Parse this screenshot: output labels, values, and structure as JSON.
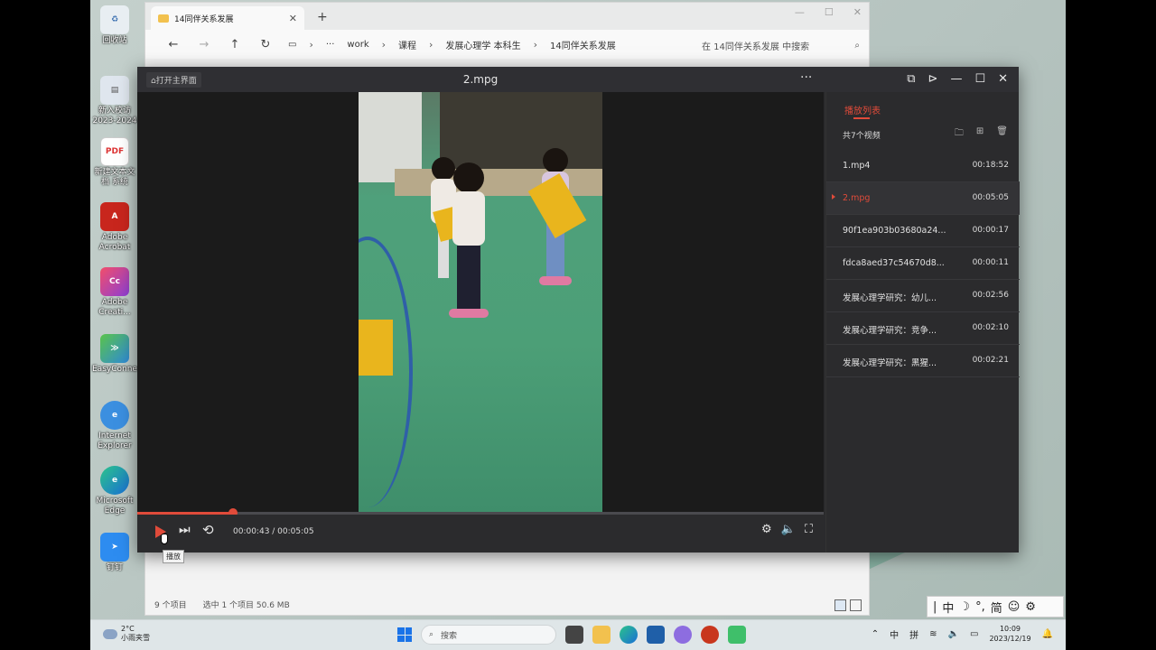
{
  "desktop": {
    "icons": [
      {
        "label": "回收站",
        "icon": "recycle-bin-icon"
      },
      {
        "label": "新入校访 2023-2024",
        "icon": "document-icon"
      },
      {
        "label": "新建文本文档 系统",
        "icon": "pdf-icon"
      },
      {
        "label": "Adobe Acrobat",
        "icon": "acrobat-icon"
      },
      {
        "label": "Adobe Creati...",
        "icon": "creative-cloud-icon"
      },
      {
        "label": "EasyConnect",
        "icon": "easyconnect-icon"
      },
      {
        "label": "Internet Explorer",
        "icon": "ie-icon"
      },
      {
        "label": "Microsoft Edge",
        "icon": "edge-icon"
      },
      {
        "label": "钉钉",
        "icon": "dingtalk-icon"
      }
    ]
  },
  "explorer": {
    "tab_title": "14同伴关系发展",
    "new_tab": "+",
    "breadcrumb": [
      "work",
      "课程",
      "发展心理学 本科生",
      "14同伴关系发展"
    ],
    "more": "···",
    "search_placeholder": "在 14同伴关系发展 中搜索",
    "status": {
      "items": "9 个项目",
      "selected": "选中 1 个项目  50.6 MB"
    }
  },
  "player": {
    "home_label": "打开主界面",
    "title": "2.mpg",
    "more": "···",
    "time": "00:00:43 / 00:05:05",
    "progress": 0.14,
    "tooltip": "播放",
    "playlist": {
      "tab": "播放列表",
      "count": "共7个视频",
      "items": [
        {
          "name": "1.mp4",
          "duration": "00:18:52",
          "active": false
        },
        {
          "name": "2.mpg",
          "duration": "00:05:05",
          "active": true
        },
        {
          "name": "90f1ea903b03680a24...",
          "duration": "00:00:17",
          "active": false
        },
        {
          "name": "fdca8aed37c54670d8...",
          "duration": "00:00:11",
          "active": false
        },
        {
          "name": "发展心理学研究：幼儿...",
          "duration": "00:02:56",
          "active": false
        },
        {
          "name": "发展心理学研究：竞争...",
          "duration": "00:02:10",
          "active": false
        },
        {
          "name": "发展心理学研究：黑猩...",
          "duration": "00:02:21",
          "active": false
        }
      ]
    }
  },
  "ime": {
    "items": [
      "中",
      "☽",
      "°,",
      "简",
      "☺",
      "⚙"
    ]
  },
  "taskbar": {
    "weather_temp": "2°C",
    "weather_text": "小雨夹雪",
    "search": "搜索",
    "tray_ime1": "中",
    "tray_ime2": "拼",
    "time": "10:09",
    "date": "2023/12/19"
  },
  "colors": {
    "accent": "#e04b3a",
    "player_bg": "#2b2b2d"
  }
}
